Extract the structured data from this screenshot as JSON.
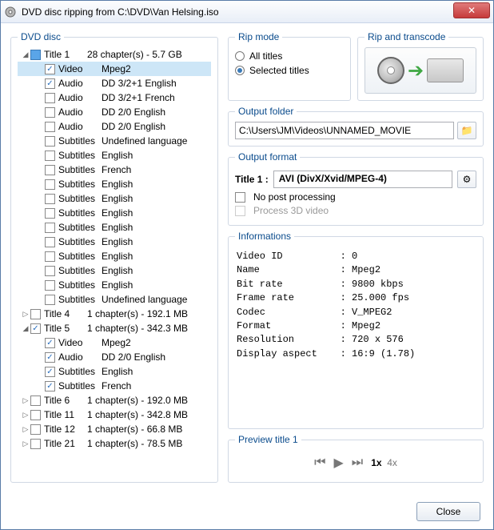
{
  "window": {
    "title": "DVD disc ripping from C:\\DVD\\Van Helsing.iso"
  },
  "tree": {
    "header": "DVD disc",
    "rows": [
      {
        "indent": 0,
        "exp": "down",
        "cb": "filled",
        "label": "Title 1",
        "info": "28 chapter(s) - 5.7 GB",
        "sel": false
      },
      {
        "indent": 1,
        "exp": "",
        "cb": "checked",
        "label": "Video",
        "info": "Mpeg2",
        "sel": true
      },
      {
        "indent": 1,
        "exp": "",
        "cb": "checked",
        "label": "Audio",
        "info": "DD 3/2+1 English",
        "sel": false
      },
      {
        "indent": 1,
        "exp": "",
        "cb": "",
        "label": "Audio",
        "info": "DD 3/2+1 French",
        "sel": false
      },
      {
        "indent": 1,
        "exp": "",
        "cb": "",
        "label": "Audio",
        "info": "DD 2/0 English",
        "sel": false
      },
      {
        "indent": 1,
        "exp": "",
        "cb": "",
        "label": "Audio",
        "info": "DD 2/0 English",
        "sel": false
      },
      {
        "indent": 1,
        "exp": "",
        "cb": "",
        "label": "Subtitles",
        "info": "Undefined language",
        "sel": false
      },
      {
        "indent": 1,
        "exp": "",
        "cb": "",
        "label": "Subtitles",
        "info": "English",
        "sel": false
      },
      {
        "indent": 1,
        "exp": "",
        "cb": "",
        "label": "Subtitles",
        "info": "French",
        "sel": false
      },
      {
        "indent": 1,
        "exp": "",
        "cb": "",
        "label": "Subtitles",
        "info": "English",
        "sel": false
      },
      {
        "indent": 1,
        "exp": "",
        "cb": "",
        "label": "Subtitles",
        "info": "English",
        "sel": false
      },
      {
        "indent": 1,
        "exp": "",
        "cb": "",
        "label": "Subtitles",
        "info": "English",
        "sel": false
      },
      {
        "indent": 1,
        "exp": "",
        "cb": "",
        "label": "Subtitles",
        "info": "English",
        "sel": false
      },
      {
        "indent": 1,
        "exp": "",
        "cb": "",
        "label": "Subtitles",
        "info": "English",
        "sel": false
      },
      {
        "indent": 1,
        "exp": "",
        "cb": "",
        "label": "Subtitles",
        "info": "English",
        "sel": false
      },
      {
        "indent": 1,
        "exp": "",
        "cb": "",
        "label": "Subtitles",
        "info": "English",
        "sel": false
      },
      {
        "indent": 1,
        "exp": "",
        "cb": "",
        "label": "Subtitles",
        "info": "English",
        "sel": false
      },
      {
        "indent": 1,
        "exp": "",
        "cb": "",
        "label": "Subtitles",
        "info": "Undefined language",
        "sel": false
      },
      {
        "indent": 0,
        "exp": "right",
        "cb": "",
        "label": "Title 4",
        "info": "1 chapter(s) - 192.1 MB",
        "sel": false
      },
      {
        "indent": 0,
        "exp": "down",
        "cb": "checked",
        "label": "Title 5",
        "info": "1 chapter(s) - 342.3 MB",
        "sel": false
      },
      {
        "indent": 1,
        "exp": "",
        "cb": "checked",
        "label": "Video",
        "info": "Mpeg2",
        "sel": false
      },
      {
        "indent": 1,
        "exp": "",
        "cb": "checked",
        "label": "Audio",
        "info": "DD 2/0 English",
        "sel": false
      },
      {
        "indent": 1,
        "exp": "",
        "cb": "checked",
        "label": "Subtitles",
        "info": "English",
        "sel": false
      },
      {
        "indent": 1,
        "exp": "",
        "cb": "checked",
        "label": "Subtitles",
        "info": "French",
        "sel": false
      },
      {
        "indent": 0,
        "exp": "right",
        "cb": "",
        "label": "Title 6",
        "info": "1 chapter(s) - 192.0 MB",
        "sel": false
      },
      {
        "indent": 0,
        "exp": "right",
        "cb": "",
        "label": "Title 11",
        "info": "1 chapter(s) - 342.8 MB",
        "sel": false
      },
      {
        "indent": 0,
        "exp": "right",
        "cb": "",
        "label": "Title 12",
        "info": "1 chapter(s) - 66.8 MB",
        "sel": false
      },
      {
        "indent": 0,
        "exp": "right",
        "cb": "",
        "label": "Title 21",
        "info": "1 chapter(s) - 78.5 MB",
        "sel": false
      }
    ]
  },
  "ripmode": {
    "legend": "Rip mode",
    "all": "All titles",
    "selected": "Selected titles",
    "value": "selected"
  },
  "transcode": {
    "legend": "Rip and transcode"
  },
  "output_folder": {
    "legend": "Output folder",
    "value": "C:\\Users\\JM\\Videos\\UNNAMED_MOVIE"
  },
  "output_format": {
    "legend": "Output format",
    "title_label": "Title 1 :",
    "format": "AVI (DivX/Xvid/MPEG-4)",
    "no_post": "No post processing",
    "process_3d": "Process 3D video"
  },
  "informations": {
    "legend": "Informations",
    "lines": "Video ID          : 0\nName              : Mpeg2\nBit rate          : 9800 kbps\nFrame rate        : 25.000 fps\nCodec             : V_MPEG2\nFormat            : Mpeg2\nResolution        : 720 x 576\nDisplay aspect    : 16:9 (1.78)"
  },
  "preview": {
    "legend": "Preview title 1",
    "speed1": "1x",
    "speed4": "4x"
  },
  "footer": {
    "close": "Close"
  }
}
